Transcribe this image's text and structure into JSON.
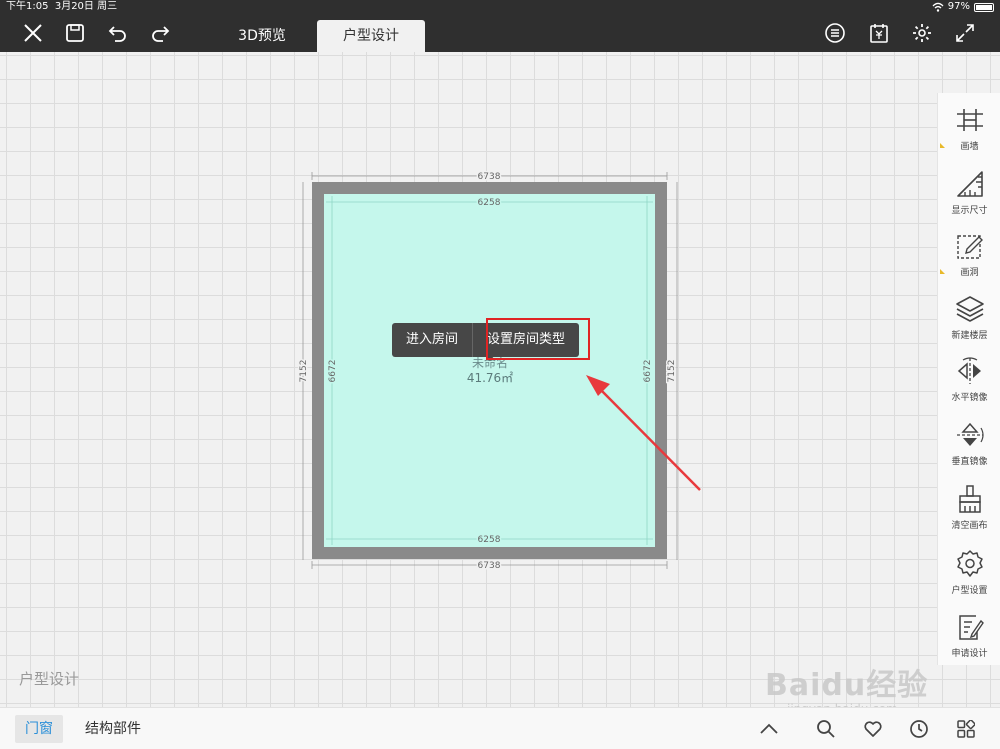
{
  "status_bar": {
    "time": "下午1:05",
    "date": "3月20日 周三",
    "battery": "97%"
  },
  "tabs": [
    {
      "label": "3D预览"
    },
    {
      "label": "户型设计"
    }
  ],
  "room": {
    "outer_width": "6738",
    "inner_width": "6258",
    "outer_height": "7152",
    "inner_height": "6672",
    "name": "未命名",
    "area": "41.76㎡"
  },
  "context_menu": {
    "enter_room": "进入房间",
    "set_room_type": "设置房间类型"
  },
  "sidebar": {
    "items": [
      {
        "label": "画墙",
        "icon": "wall-draw-icon"
      },
      {
        "label": "显示尺寸",
        "icon": "ruler-icon"
      },
      {
        "label": "画洞",
        "icon": "hole-draw-icon"
      },
      {
        "label": "新建楼层",
        "icon": "layers-icon"
      },
      {
        "label": "水平镜像",
        "icon": "mirror-horizontal-icon"
      },
      {
        "label": "垂直镜像",
        "icon": "mirror-vertical-icon"
      },
      {
        "label": "清空画布",
        "icon": "brush-icon"
      },
      {
        "label": "户型设置",
        "icon": "gear-icon"
      },
      {
        "label": "申请设计",
        "icon": "apply-design-icon"
      }
    ]
  },
  "canvas_label": "户型设计",
  "bottom_bar": {
    "tab_doors": "门窗",
    "tab_structure": "结构部件"
  },
  "watermark": {
    "brand": "Baidu经验",
    "url": "jingyan.baidu.com"
  },
  "colors": {
    "topbar": "#2f2f2f",
    "room_fill": "#c5f7ec",
    "wall": "#8a8a8a",
    "highlight": "#e02424",
    "accent": "#2a8fd8"
  }
}
